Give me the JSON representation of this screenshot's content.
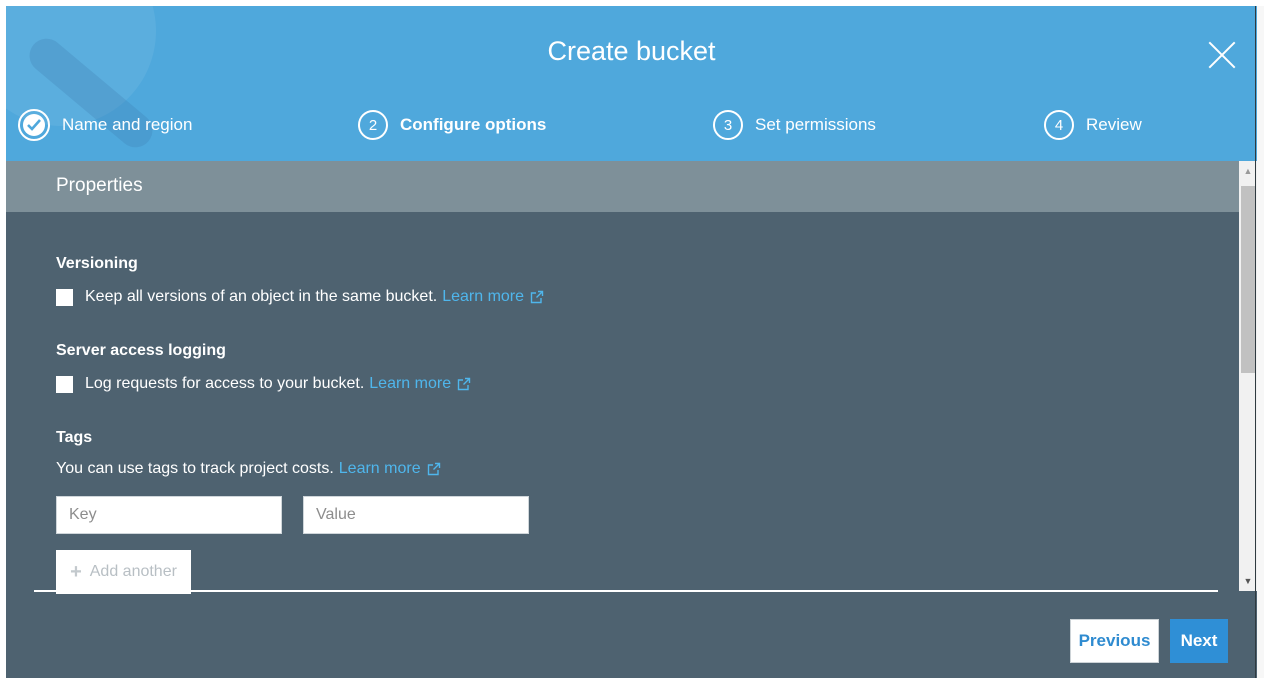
{
  "dialog": {
    "title": "Create bucket"
  },
  "steps": [
    {
      "number": "",
      "label": "Name and region",
      "state": "complete"
    },
    {
      "number": "2",
      "label": "Configure options",
      "state": "active"
    },
    {
      "number": "3",
      "label": "Set permissions",
      "state": "pending"
    },
    {
      "number": "4",
      "label": "Review",
      "state": "pending"
    }
  ],
  "properties": {
    "header": "Properties",
    "versioning": {
      "title": "Versioning",
      "checkbox_label": "Keep all versions of an object in the same bucket.",
      "checked": false,
      "learn_more": "Learn more"
    },
    "logging": {
      "title": "Server access logging",
      "checkbox_label": "Log requests for access to your bucket.",
      "checked": false,
      "learn_more": "Learn more"
    },
    "tags": {
      "title": "Tags",
      "description": "You can use tags to track project costs.",
      "learn_more": "Learn more",
      "key_placeholder": "Key",
      "key_value": "",
      "value_placeholder": "Value",
      "value_value": "",
      "add_another": "Add another"
    }
  },
  "footer": {
    "previous_label": "Previous",
    "next_label": "Next"
  },
  "colors": {
    "header_bg": "#4fa8dc",
    "body_bg": "#4e6270",
    "properties_bar": "#7e9099",
    "link": "#4fb6ec",
    "primary_button": "#2f8fd6"
  },
  "icons": {
    "close": "close-icon",
    "check": "check-circle-icon",
    "external": "external-link-icon",
    "plus": "plus-icon"
  }
}
